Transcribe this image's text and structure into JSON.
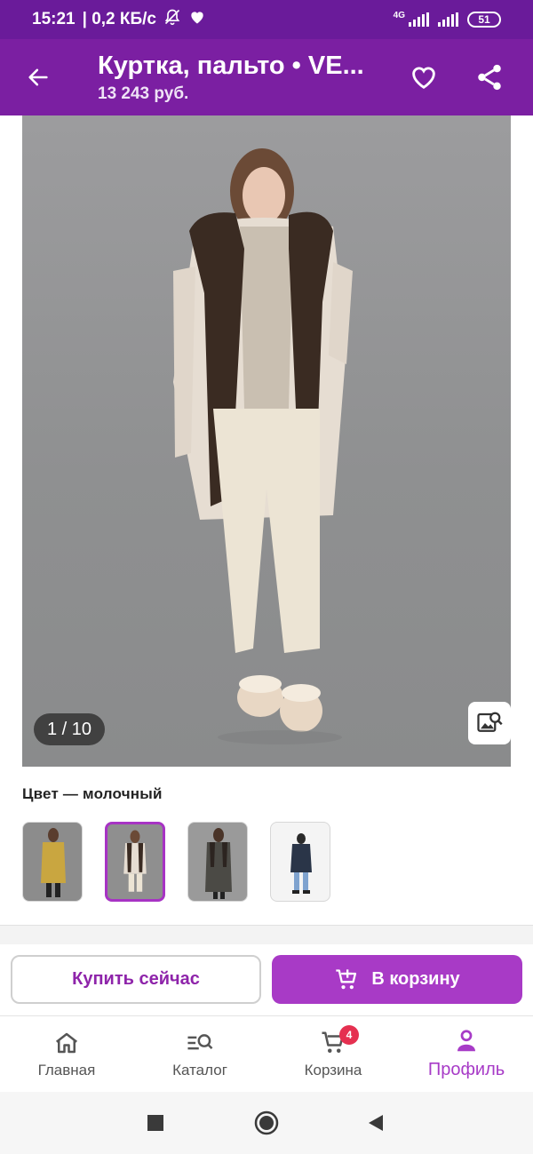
{
  "status_bar": {
    "time": "15:21",
    "network_speed": "| 0,2 КБ/с",
    "net_type": "4G",
    "battery": "51"
  },
  "header": {
    "title": "Куртка, пальто • VE...",
    "price": "13 243 руб."
  },
  "gallery": {
    "counter": "1 / 10"
  },
  "color": {
    "label": "Цвет — молочный",
    "swatches": [
      {
        "name": "mustard"
      },
      {
        "name": "milky"
      },
      {
        "name": "graphite"
      },
      {
        "name": "navy"
      }
    ],
    "selected_index": 1
  },
  "actions": {
    "buy_now": "Купить сейчас",
    "add_to_cart": "В корзину"
  },
  "bottom_nav": {
    "items": [
      {
        "label": "Главная",
        "icon": "home-icon"
      },
      {
        "label": "Каталог",
        "icon": "catalog-search-icon"
      },
      {
        "label": "Корзина",
        "icon": "cart-icon",
        "badge": "4"
      },
      {
        "label": "Профиль",
        "icon": "profile-icon",
        "active": true
      }
    ]
  },
  "colors": {
    "status_bar": "#6a1b9a",
    "app_bar": "#7b1fa2",
    "accent": "#a83ac6",
    "badge": "#e53050"
  }
}
